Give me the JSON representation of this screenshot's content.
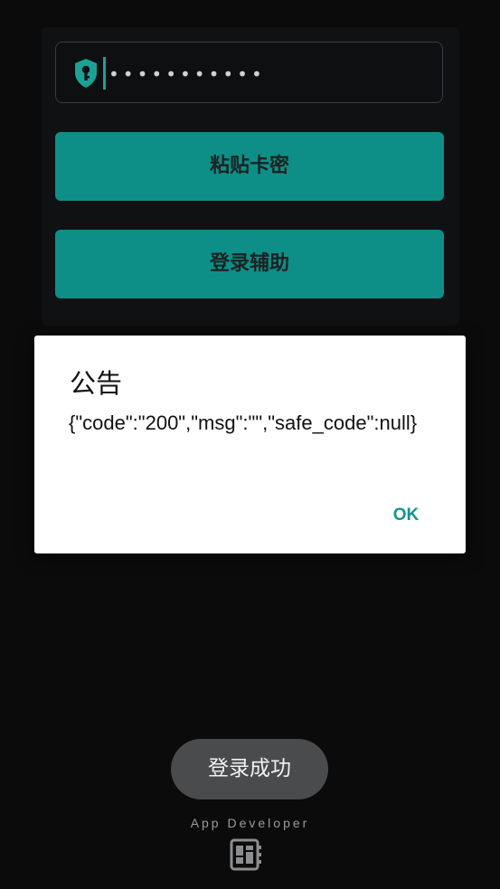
{
  "form": {
    "password_masked": "•••••••••••",
    "paste_button_label": "粘贴卡密",
    "assist_button_label": "登录辅助"
  },
  "dialog": {
    "title": "公告",
    "message": "{\"code\":\"200\",\"msg\":\"\",\"safe_code\":null}",
    "ok_label": "OK"
  },
  "toast": {
    "text": "登录成功"
  },
  "footer": {
    "developer_label": "App Developer"
  },
  "colors": {
    "accent": "#0d8f87",
    "ok_text": "#12968b",
    "background": "#0b0b0c"
  },
  "icons": {
    "field_icon": "shield-key-icon",
    "footer_icon": "developer-board-icon"
  }
}
